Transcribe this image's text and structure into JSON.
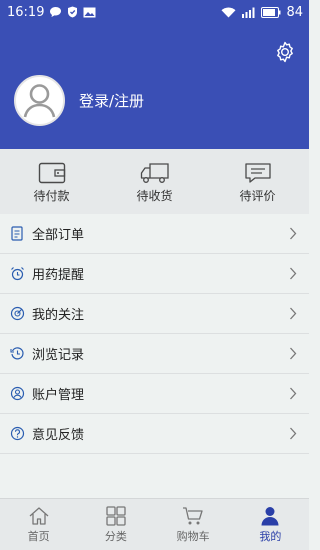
{
  "status_bar": {
    "time": "16:19",
    "battery": "84"
  },
  "profile": {
    "login_label": "登录/注册"
  },
  "orders": [
    {
      "label": "待付款",
      "icon": "wallet-icon"
    },
    {
      "label": "待收货",
      "icon": "truck-icon"
    },
    {
      "label": "待评价",
      "icon": "comment-icon"
    }
  ],
  "menu": [
    {
      "label": "全部订单",
      "icon": "document-icon"
    },
    {
      "label": "用药提醒",
      "icon": "alarm-clock-icon"
    },
    {
      "label": "我的关注",
      "icon": "target-icon"
    },
    {
      "label": "浏览记录",
      "icon": "history-icon"
    },
    {
      "label": "账户管理",
      "icon": "user-circle-icon"
    },
    {
      "label": "意见反馈",
      "icon": "question-icon"
    }
  ],
  "bottom_nav": [
    {
      "label": "首页",
      "icon": "home-icon"
    },
    {
      "label": "分类",
      "icon": "grid-icon"
    },
    {
      "label": "购物车",
      "icon": "cart-icon"
    },
    {
      "label": "我的",
      "icon": "person-icon",
      "active": true
    }
  ],
  "colors": {
    "header": "#3a4fb5",
    "active": "#2a3fa8",
    "icon_blue": "#2a5db0"
  }
}
